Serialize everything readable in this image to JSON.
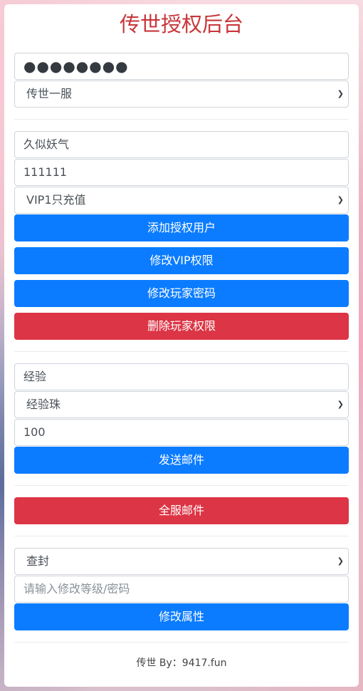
{
  "title": "传世授权后台",
  "auth": {
    "password_value": "●●●●●●●●",
    "server_select": "传世一服"
  },
  "user": {
    "name_value": "久似妖气",
    "password_value": "111111",
    "vip_select": "VIP1只充值",
    "buttons": {
      "add_user": "添加授权用户",
      "modify_vip": "修改VIP权限",
      "modify_password": "修改玩家密码",
      "delete_permission": "删除玩家权限"
    }
  },
  "mail": {
    "item_value": "经验",
    "item_select": "经验珠",
    "quantity_value": "100",
    "send_button": "发送邮件"
  },
  "server_mail": {
    "button": "全服邮件"
  },
  "attributes": {
    "action_select": "查封",
    "input_placeholder": "请输入修改等级/密码",
    "modify_button": "修改属性"
  },
  "footer": {
    "text": "传世 By：9417.fun"
  },
  "colors": {
    "title": "#c8363a",
    "primary": "#0b7cff",
    "danger": "#dc3545"
  },
  "icons": {
    "select_arrow": "chevron-down-icon"
  }
}
